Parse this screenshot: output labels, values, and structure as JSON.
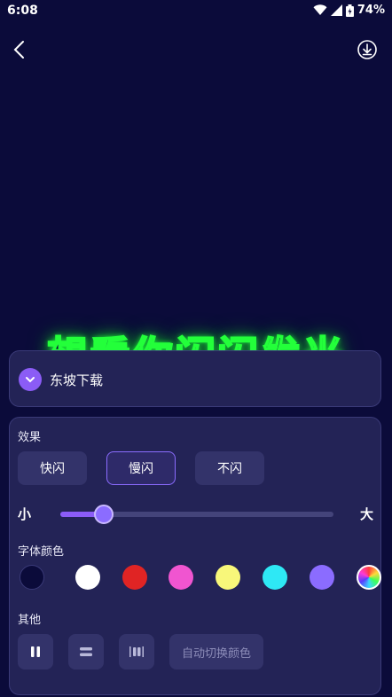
{
  "status": {
    "time": "6:08",
    "battery": "74%"
  },
  "preview": {
    "text": "想看你闪闪发光",
    "glow_color": "#23ff3a"
  },
  "font_card": {
    "name": "东坡下载"
  },
  "effect": {
    "label": "效果",
    "options": [
      "快闪",
      "慢闪",
      "不闪"
    ],
    "selected": "慢闪"
  },
  "size": {
    "min_label": "小",
    "max_label": "大",
    "value": 0.16
  },
  "font_color": {
    "label": "字体颜色",
    "swatches": [
      "#0b0b3a",
      "#ffffff",
      "#e02424",
      "#f055d0",
      "#f8f77a",
      "#2ee8f5",
      "#8b6cff",
      "rainbow"
    ]
  },
  "other": {
    "label": "其他",
    "auto_color_label": "自动切换颜色"
  },
  "colors": {
    "accent": "#8b5cf6",
    "background": "#0b0b3a",
    "card": "#232356"
  }
}
